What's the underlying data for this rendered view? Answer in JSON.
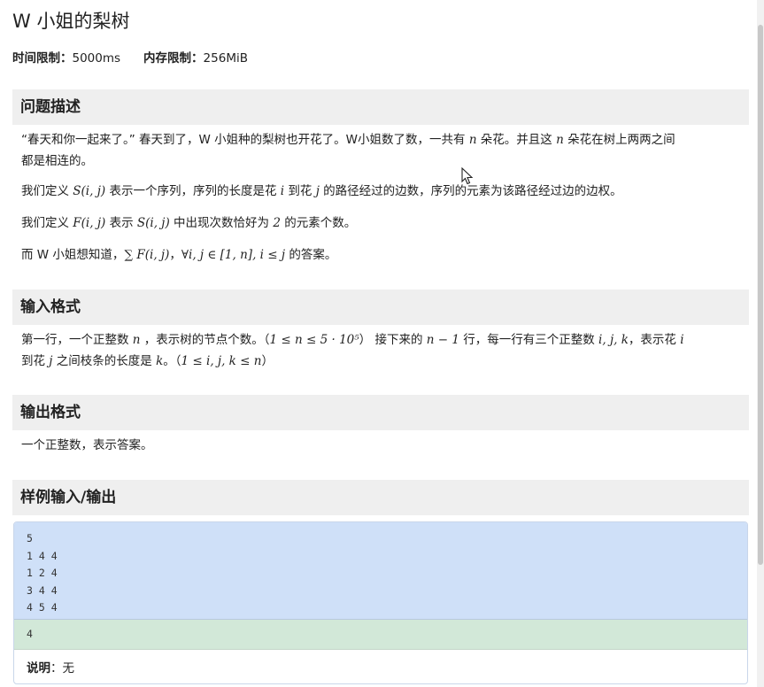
{
  "problem": {
    "title": "W 小姐的梨树",
    "time_limit_label": "时间限制：",
    "time_limit_value": "5000ms",
    "memory_limit_label": "内存限制：",
    "memory_limit_value": "256MiB"
  },
  "description": {
    "heading": "问题描述",
    "p1": {
      "t1": "“春天和你一起来了。” 春天到了，W 小姐种的梨树也开花了。W小姐数了数，一共有 ",
      "m1": "n",
      "t2": " 朵花。并且这 ",
      "m2": "n",
      "t3": " 朵花在树上两两之间",
      "t4": "都是相连的。"
    },
    "p2": {
      "t1": "我们定义 ",
      "m1": "S(i, j)",
      "t2": " 表示一个序列，序列的长度是花 ",
      "m2": "i",
      "t3": " 到花 ",
      "m3": "j",
      "t4": " 的路径经过的边数，序列的元素为该路径经过边的边权。"
    },
    "p3": {
      "t1": "我们定义 ",
      "m1": "F(i, j)",
      "t2": " 表示 ",
      "m2": "S(i, j)",
      "t3": " 中出现次数恰好为 ",
      "m3": "2",
      "t4": " 的元素个数。"
    },
    "p4": {
      "t1": "而 W 小姐想知道，",
      "m1": "∑ F(i, j)",
      "t2": "，",
      "m2": "∀i, j ∈ [1, n], i ≤ j",
      "t3": " 的答案。"
    }
  },
  "input_format": {
    "heading": "输入格式",
    "t1": "第一行，一个正整数 ",
    "m1": "n",
    "t2": " ，表示树的节点个数。（",
    "m2": "1 ≤ n ≤ 5 · 10⁵",
    "t3": "） 接下来的 ",
    "m3": "n − 1",
    "t4": " 行，每一行有三个正整数 ",
    "m4": "i, j, k",
    "t5": "，表示花 ",
    "m5": "i",
    "t6": "到花 ",
    "m6": "j",
    "t7": " 之间枝条的长度是 ",
    "m7": "k",
    "t8": "。（",
    "m8": "1 ≤ i, j, k ≤ n",
    "t9": "）"
  },
  "output_format": {
    "heading": "输出格式",
    "text": "一个正整数，表示答案。"
  },
  "sample": {
    "heading": "样例输入/输出",
    "input_lines": [
      "5",
      "1 4 4",
      "1 2 4",
      "3 4 4",
      "4 5 4"
    ],
    "output_lines": [
      "4"
    ],
    "note_label": "说明",
    "note_sep": "：",
    "note_value": "无"
  },
  "colors": {
    "section_bg": "#efefef",
    "sample_input_bg": "#cfe0f8",
    "sample_output_bg": "#d2e8d8"
  }
}
